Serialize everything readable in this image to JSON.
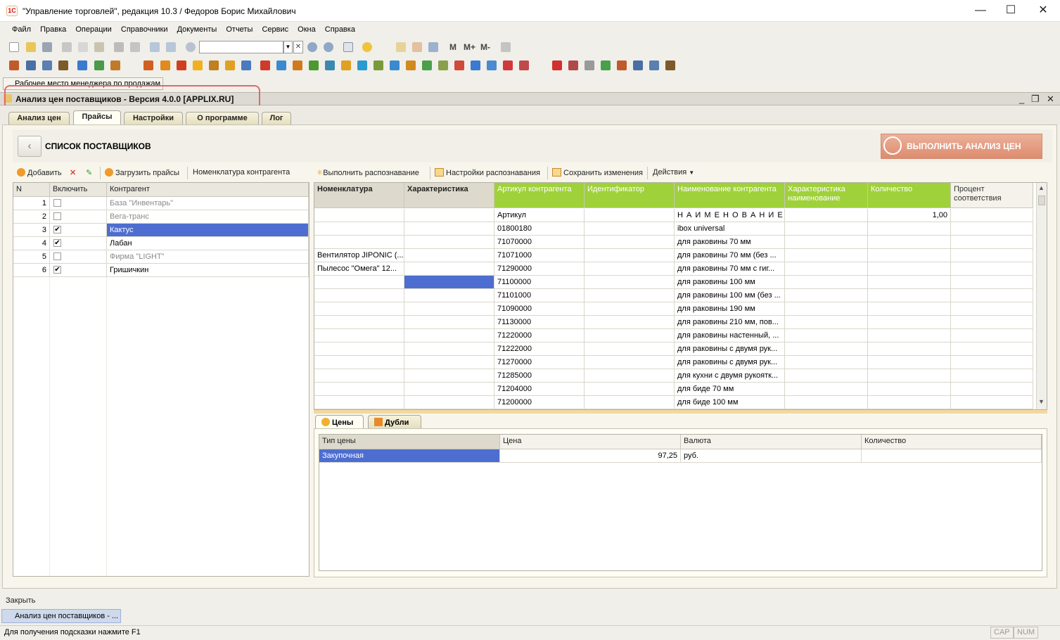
{
  "window": {
    "title": "\"Управление торговлей\", редакция 10.3 / Федоров Борис Михайлович",
    "icon": "1c-logo-icon",
    "controls": {
      "minimize": "—",
      "maximize": "☐",
      "close": "✕"
    }
  },
  "menu": [
    "Файл",
    "Правка",
    "Операции",
    "Справочники",
    "Документы",
    "Отчеты",
    "Сервис",
    "Окна",
    "Справка"
  ],
  "toolbar": {
    "memory_buttons": [
      "M",
      "M+",
      "M-"
    ]
  },
  "top_task": {
    "label": "Рабочее место менеджера по продажам"
  },
  "document": {
    "title": "Анализ цен поставщиков - Версия 4.0.0 [APPLIX.RU]",
    "controls": {
      "minimize": "_",
      "restore": "❐",
      "close": "✕"
    }
  },
  "tabs": [
    {
      "label": "Анализ цен",
      "active": false
    },
    {
      "label": "Прайсы",
      "active": true
    },
    {
      "label": "Настройки",
      "active": false
    },
    {
      "label": "О программе",
      "active": false
    },
    {
      "label": "Лог",
      "active": false
    }
  ],
  "header": {
    "back_icon": "back-arrow-icon",
    "list_title": "СПИСОК ПОСТАВЩИКОВ",
    "run_button": "ВЫПОЛНИТЬ АНАЛИЗ ЦЕН"
  },
  "suppliers_toolbar": {
    "add": "Добавить",
    "load": "Загрузить прайсы",
    "nomenclature": "Номенклатура контрагента"
  },
  "suppliers_table": {
    "columns": [
      "N",
      "Включить",
      "Контрагент"
    ],
    "rows": [
      {
        "n": "1",
        "checked": false,
        "name": "База \"Инвентарь\"",
        "active": false,
        "selected": false
      },
      {
        "n": "2",
        "checked": false,
        "name": "Вега-транс",
        "active": false,
        "selected": false
      },
      {
        "n": "3",
        "checked": true,
        "name": "Кактус",
        "active": true,
        "selected": true
      },
      {
        "n": "4",
        "checked": true,
        "name": "Лабан",
        "active": true,
        "selected": false
      },
      {
        "n": "5",
        "checked": false,
        "name": "Фирма \"LIGHT\"",
        "active": false,
        "selected": false
      },
      {
        "n": "6",
        "checked": true,
        "name": "Гришичкин",
        "active": true,
        "selected": false
      }
    ],
    "check_mark": "✔"
  },
  "price_toolbar": {
    "recognize": "Выполнить распознавание",
    "settings": "Настройки распознавания",
    "save": "Сохранить изменения",
    "actions": "Действия"
  },
  "price_table": {
    "columns": [
      "Номенклатура",
      "Характеристика",
      "Артикул контрагента",
      "Идентификатор",
      "Наименование контрагента",
      "Характеристика наименование",
      "Количество",
      "Процент соответствия"
    ],
    "rows": [
      [
        "",
        "",
        "Артикул",
        "",
        "Н А И М Е Н О В А Н И Е ...",
        "",
        "1,00",
        ""
      ],
      [
        "",
        "",
        "01800180",
        "",
        "ibox universal",
        "",
        "",
        ""
      ],
      [
        "",
        "",
        "71070000",
        "",
        "для раковины 70 мм",
        "",
        "",
        ""
      ],
      [
        "Вентилятор JIPONIC (...",
        "",
        "71071000",
        "",
        "для раковины 70 мм (без ...",
        "",
        "",
        ""
      ],
      [
        "Пылесос \"Омега\" 12...",
        "",
        "71290000",
        "",
        "для раковины 70 мм с гиг...",
        "",
        "",
        ""
      ],
      [
        "",
        "",
        "71100000",
        "",
        "для раковины 100 мм",
        "",
        "",
        ""
      ],
      [
        "",
        "",
        "71101000",
        "",
        "для раковины 100 мм (без ...",
        "",
        "",
        ""
      ],
      [
        "",
        "",
        "71090000",
        "",
        "для раковины 190 мм",
        "",
        "",
        ""
      ],
      [
        "",
        "",
        "71130000",
        "",
        "для раковины 210 мм, пов...",
        "",
        "",
        ""
      ],
      [
        "",
        "",
        "71220000",
        "",
        "для раковины настенный, ...",
        "",
        "",
        ""
      ],
      [
        "",
        "",
        "71222000",
        "",
        "для раковины с двумя рук...",
        "",
        "",
        ""
      ],
      [
        "",
        "",
        "71270000",
        "",
        "для раковины с двумя рук...",
        "",
        "",
        ""
      ],
      [
        "",
        "",
        "71285000",
        "",
        "для кухни с двумя рукоятк...",
        "",
        "",
        ""
      ],
      [
        "",
        "",
        "71204000",
        "",
        "для биде 70 мм",
        "",
        "",
        ""
      ],
      [
        "",
        "",
        "71200000",
        "",
        "для биде 100 мм",
        "",
        "",
        ""
      ]
    ],
    "scroll_up": "▲",
    "scroll_down": "▼"
  },
  "bottom_tabs": [
    {
      "label": "Цены",
      "active": true
    },
    {
      "label": "Дубли",
      "active": false
    }
  ],
  "prices_table": {
    "columns": [
      "Тип цены",
      "Цена",
      "Валюта",
      "Количество"
    ],
    "rows": [
      [
        "Закупочная",
        "97,25",
        "руб.",
        ""
      ]
    ]
  },
  "close_bar": "Закрыть",
  "bottom_task": "Анализ цен поставщиков - ...",
  "status": {
    "hint": "Для получения подсказки нажмите F1",
    "cap": "CAP",
    "num": "NUM"
  },
  "colors": {
    "accent_green": "#9fd13a",
    "selection": "#4d6ed0",
    "run_button": "#e29a7e"
  }
}
